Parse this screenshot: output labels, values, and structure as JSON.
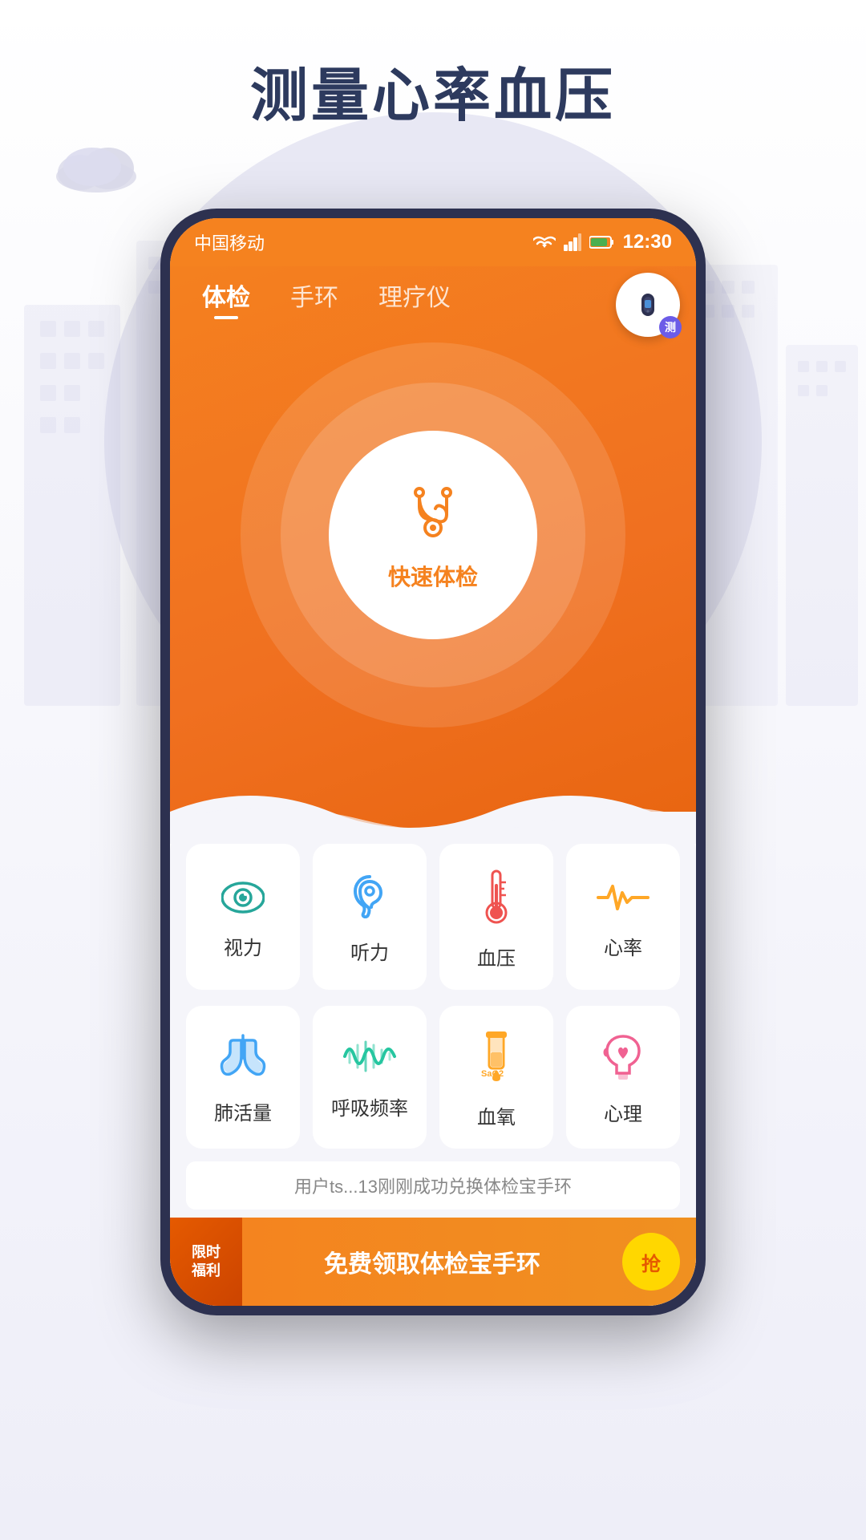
{
  "page": {
    "title": "测量心率血压",
    "background_color": "#f0f0f8"
  },
  "status_bar": {
    "carrier": "中国移动",
    "time": "12:30",
    "wifi": "wifi",
    "signal": "signal",
    "battery": "battery"
  },
  "nav": {
    "tabs": [
      {
        "id": "tijian",
        "label": "体检",
        "active": true
      },
      {
        "id": "shoulian",
        "label": "手环",
        "active": false
      },
      {
        "id": "liaoyi",
        "label": "理疗仪",
        "active": false
      }
    ]
  },
  "quick_check": {
    "icon": "🩺",
    "label": "快速体检"
  },
  "wristband_btn": {
    "badge": "测"
  },
  "grid_row1": [
    {
      "id": "vision",
      "icon": "👁",
      "label": "视力",
      "icon_type": "eye"
    },
    {
      "id": "hearing",
      "icon": "👂",
      "label": "听力",
      "icon_type": "ear"
    },
    {
      "id": "bp",
      "icon": "🌡",
      "label": "血压",
      "icon_type": "bp"
    },
    {
      "id": "heart",
      "icon": "💗",
      "label": "心率",
      "icon_type": "heart"
    }
  ],
  "grid_row2": [
    {
      "id": "lung",
      "icon": "🫁",
      "label": "肺活量",
      "icon_type": "lung"
    },
    {
      "id": "breath",
      "icon": "〰",
      "label": "呼吸频率",
      "icon_type": "wave"
    },
    {
      "id": "blood_oxy",
      "icon": "🧪",
      "label": "血氧",
      "icon_type": "blood"
    },
    {
      "id": "mental",
      "icon": "🧠",
      "label": "心理",
      "icon_type": "brain"
    }
  ],
  "marquee": {
    "text": "用户ts...13刚刚成功兑换体检宝手环"
  },
  "banner": {
    "badge_line1": "限时",
    "badge_line2": "福利",
    "main_text": "免费领取体检宝手环",
    "grab_label": "抢"
  }
}
